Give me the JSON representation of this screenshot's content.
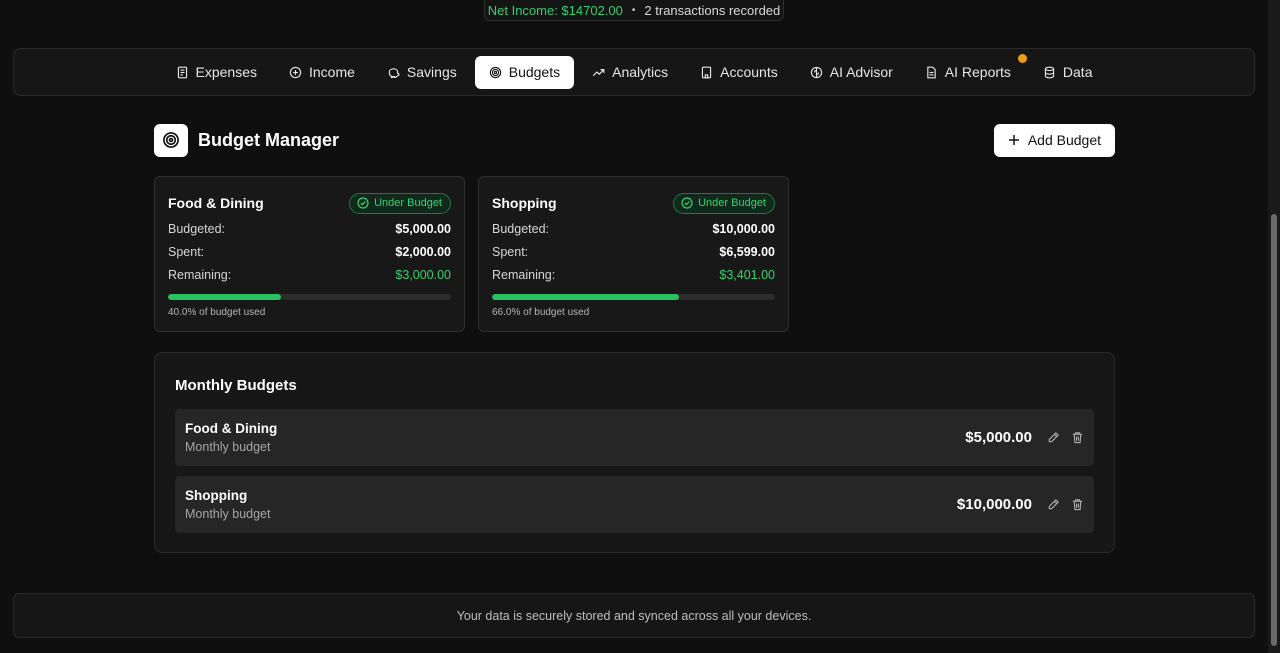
{
  "summary": {
    "net_income": "Net Income: $14702.00",
    "separator": "•",
    "transactions": "2 transactions recorded"
  },
  "nav": {
    "tabs": [
      {
        "label": "Expenses",
        "icon": "receipt-icon"
      },
      {
        "label": "Income",
        "icon": "plus-circle-icon"
      },
      {
        "label": "Savings",
        "icon": "piggy-bank-icon"
      },
      {
        "label": "Budgets",
        "icon": "target-icon",
        "active": true
      },
      {
        "label": "Analytics",
        "icon": "trending-up-icon"
      },
      {
        "label": "Accounts",
        "icon": "building-icon"
      },
      {
        "label": "AI Advisor",
        "icon": "brain-icon"
      },
      {
        "label": "AI Reports",
        "icon": "file-text-icon",
        "badge": true
      },
      {
        "label": "Data",
        "icon": "database-icon"
      }
    ]
  },
  "page": {
    "title": "Budget Manager",
    "add_button": "Add Budget"
  },
  "labels": {
    "budgeted": "Budgeted:",
    "spent": "Spent:",
    "remaining": "Remaining:"
  },
  "cards": [
    {
      "name": "Food & Dining",
      "status": "Under Budget",
      "budgeted": "$5,000.00",
      "spent": "$2,000.00",
      "remaining": "$3,000.00",
      "used_fraction": 0.4,
      "used_text": "40.0% of budget used"
    },
    {
      "name": "Shopping",
      "status": "Under Budget",
      "budgeted": "$10,000.00",
      "spent": "$6,599.00",
      "remaining": "$3,401.00",
      "used_fraction": 0.66,
      "used_text": "66.0% of budget used"
    }
  ],
  "monthly": {
    "title": "Monthly Budgets",
    "items": [
      {
        "name": "Food & Dining",
        "sub": "Monthly budget",
        "amount": "$5,000.00"
      },
      {
        "name": "Shopping",
        "sub": "Monthly budget",
        "amount": "$10,000.00"
      }
    ]
  },
  "footer": {
    "text": "Your data is securely stored and synced across all your devices."
  },
  "colors": {
    "accent_green": "#22c55e",
    "badge_orange": "#f59e0b",
    "background": "#0f0f0f"
  }
}
